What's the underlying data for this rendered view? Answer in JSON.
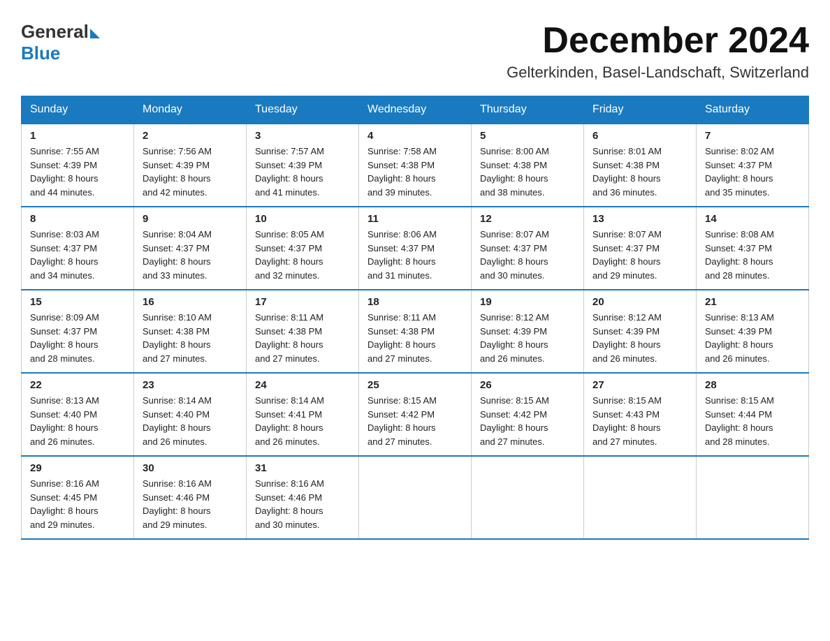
{
  "logo": {
    "general": "General",
    "blue": "Blue"
  },
  "title": "December 2024",
  "subtitle": "Gelterkinden, Basel-Landschaft, Switzerland",
  "days_of_week": [
    "Sunday",
    "Monday",
    "Tuesday",
    "Wednesday",
    "Thursday",
    "Friday",
    "Saturday"
  ],
  "weeks": [
    [
      {
        "day": "1",
        "sunrise": "7:55 AM",
        "sunset": "4:39 PM",
        "daylight": "8 hours and 44 minutes."
      },
      {
        "day": "2",
        "sunrise": "7:56 AM",
        "sunset": "4:39 PM",
        "daylight": "8 hours and 42 minutes."
      },
      {
        "day": "3",
        "sunrise": "7:57 AM",
        "sunset": "4:39 PM",
        "daylight": "8 hours and 41 minutes."
      },
      {
        "day": "4",
        "sunrise": "7:58 AM",
        "sunset": "4:38 PM",
        "daylight": "8 hours and 39 minutes."
      },
      {
        "day": "5",
        "sunrise": "8:00 AM",
        "sunset": "4:38 PM",
        "daylight": "8 hours and 38 minutes."
      },
      {
        "day": "6",
        "sunrise": "8:01 AM",
        "sunset": "4:38 PM",
        "daylight": "8 hours and 36 minutes."
      },
      {
        "day": "7",
        "sunrise": "8:02 AM",
        "sunset": "4:37 PM",
        "daylight": "8 hours and 35 minutes."
      }
    ],
    [
      {
        "day": "8",
        "sunrise": "8:03 AM",
        "sunset": "4:37 PM",
        "daylight": "8 hours and 34 minutes."
      },
      {
        "day": "9",
        "sunrise": "8:04 AM",
        "sunset": "4:37 PM",
        "daylight": "8 hours and 33 minutes."
      },
      {
        "day": "10",
        "sunrise": "8:05 AM",
        "sunset": "4:37 PM",
        "daylight": "8 hours and 32 minutes."
      },
      {
        "day": "11",
        "sunrise": "8:06 AM",
        "sunset": "4:37 PM",
        "daylight": "8 hours and 31 minutes."
      },
      {
        "day": "12",
        "sunrise": "8:07 AM",
        "sunset": "4:37 PM",
        "daylight": "8 hours and 30 minutes."
      },
      {
        "day": "13",
        "sunrise": "8:07 AM",
        "sunset": "4:37 PM",
        "daylight": "8 hours and 29 minutes."
      },
      {
        "day": "14",
        "sunrise": "8:08 AM",
        "sunset": "4:37 PM",
        "daylight": "8 hours and 28 minutes."
      }
    ],
    [
      {
        "day": "15",
        "sunrise": "8:09 AM",
        "sunset": "4:37 PM",
        "daylight": "8 hours and 28 minutes."
      },
      {
        "day": "16",
        "sunrise": "8:10 AM",
        "sunset": "4:38 PM",
        "daylight": "8 hours and 27 minutes."
      },
      {
        "day": "17",
        "sunrise": "8:11 AM",
        "sunset": "4:38 PM",
        "daylight": "8 hours and 27 minutes."
      },
      {
        "day": "18",
        "sunrise": "8:11 AM",
        "sunset": "4:38 PM",
        "daylight": "8 hours and 27 minutes."
      },
      {
        "day": "19",
        "sunrise": "8:12 AM",
        "sunset": "4:39 PM",
        "daylight": "8 hours and 26 minutes."
      },
      {
        "day": "20",
        "sunrise": "8:12 AM",
        "sunset": "4:39 PM",
        "daylight": "8 hours and 26 minutes."
      },
      {
        "day": "21",
        "sunrise": "8:13 AM",
        "sunset": "4:39 PM",
        "daylight": "8 hours and 26 minutes."
      }
    ],
    [
      {
        "day": "22",
        "sunrise": "8:13 AM",
        "sunset": "4:40 PM",
        "daylight": "8 hours and 26 minutes."
      },
      {
        "day": "23",
        "sunrise": "8:14 AM",
        "sunset": "4:40 PM",
        "daylight": "8 hours and 26 minutes."
      },
      {
        "day": "24",
        "sunrise": "8:14 AM",
        "sunset": "4:41 PM",
        "daylight": "8 hours and 26 minutes."
      },
      {
        "day": "25",
        "sunrise": "8:15 AM",
        "sunset": "4:42 PM",
        "daylight": "8 hours and 27 minutes."
      },
      {
        "day": "26",
        "sunrise": "8:15 AM",
        "sunset": "4:42 PM",
        "daylight": "8 hours and 27 minutes."
      },
      {
        "day": "27",
        "sunrise": "8:15 AM",
        "sunset": "4:43 PM",
        "daylight": "8 hours and 27 minutes."
      },
      {
        "day": "28",
        "sunrise": "8:15 AM",
        "sunset": "4:44 PM",
        "daylight": "8 hours and 28 minutes."
      }
    ],
    [
      {
        "day": "29",
        "sunrise": "8:16 AM",
        "sunset": "4:45 PM",
        "daylight": "8 hours and 29 minutes."
      },
      {
        "day": "30",
        "sunrise": "8:16 AM",
        "sunset": "4:46 PM",
        "daylight": "8 hours and 29 minutes."
      },
      {
        "day": "31",
        "sunrise": "8:16 AM",
        "sunset": "4:46 PM",
        "daylight": "8 hours and 30 minutes."
      },
      null,
      null,
      null,
      null
    ]
  ],
  "labels": {
    "sunrise": "Sunrise:",
    "sunset": "Sunset:",
    "daylight": "Daylight:"
  }
}
